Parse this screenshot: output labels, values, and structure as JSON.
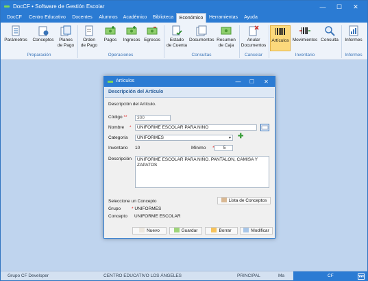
{
  "window": {
    "title": "DocCF • Software de Gestión Escolar",
    "minimize": "—",
    "maximize": "☐",
    "close": "✕"
  },
  "menu": {
    "tabs": [
      "DocCF",
      "Centro Educativo",
      "Docentes",
      "Alumnos",
      "Académico",
      "Biblioteca",
      "Económico",
      "Herramientas",
      "Ayuda"
    ],
    "active": "Económico"
  },
  "ribbon": {
    "buttons": {
      "parametros": "Parámetros",
      "conceptos": "Conceptos",
      "planes1": "Planes",
      "planes2": "de Pago",
      "orden1": "Orden",
      "orden2": "de Pago",
      "pagos": "Pagos",
      "ingresos": "Ingresos",
      "egresos": "Egresos",
      "estado1": "Estado",
      "estado2": "de Cuenta",
      "documentos": "Documentos",
      "resumen1": "Resumen",
      "resumen2": "de Caja",
      "anular1": "Anular",
      "anular2": "Documentos",
      "articulos": "Artículos",
      "movimientos": "Movimientos",
      "consulta": "Consulta",
      "informes": "Informes"
    },
    "groups": {
      "preparacion": "Preparación",
      "operaciones": "Operaciones",
      "consultas": "Consultas",
      "cancelar": "Cancelar",
      "inventario": "Inventario",
      "informes": "Informes"
    }
  },
  "dialog": {
    "title": "Artículos",
    "section": "Descripción del Artículo",
    "intro": "Descripción del Artículo.",
    "codigo_label": "Código",
    "codigo_value": "300",
    "nombre_label": "Nombre",
    "nombre_value": "UNIFORME ESCOLAR PARA NIÑO",
    "categoria_label": "Categoría",
    "categoria_value": "UNIFORMES",
    "inventario_label": "Inventario",
    "inventario_value": "10",
    "minimo_label": "Mínimo",
    "minimo_value": "5",
    "descripcion_label": "Descripción",
    "descripcion_value": "UNIFORME ESCOLAR PARA NIÑO. PANTALON, CAMISA Y ZAPATOS",
    "seleccione_label": "Seleccione un Concepto",
    "lista_button": "Lista de Conceptos",
    "grupo_label": "Grupo",
    "grupo_value": "UNIFORMES",
    "concepto_label": "Concepto",
    "concepto_value": "UNIFORME ESCOLAR",
    "buttons": {
      "nuevo": "Nuevo",
      "guardar": "Guardar",
      "borrar": "Borrar",
      "modificar": "Modificar"
    }
  },
  "status": {
    "company": "Grupo CF Developer",
    "center": "CENTRO EDUCATIVO LOS ÁNGELES",
    "branch": "PRINCIPAL",
    "user": "Ma",
    "app": "CF"
  },
  "colors": {
    "accent": "#2b7bd3",
    "ribbon_bg": "#eef3fa",
    "workspace": "#bfd4ee",
    "selected": "#fcd97c",
    "required": "#e02020"
  }
}
